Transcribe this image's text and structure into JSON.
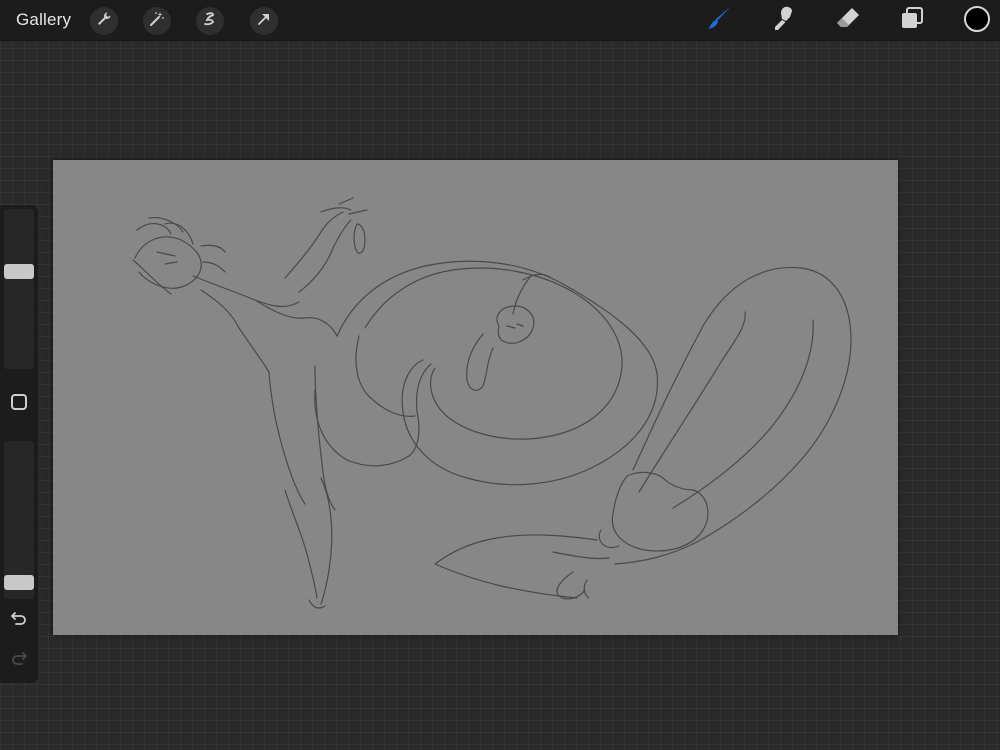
{
  "topbar": {
    "gallery_label": "Gallery",
    "left_tools": [
      "wrench-icon",
      "magic-wand-icon",
      "selection-icon",
      "transform-arrow-icon"
    ],
    "right_tools": [
      "brush-icon",
      "smudge-icon",
      "eraser-icon",
      "layers-icon"
    ],
    "active_tool": "brush",
    "accent_color": "#1a6fe0",
    "current_color": "#000000"
  },
  "sidebar": {
    "brush_size_level": 0.62,
    "opacity_level": 0.06,
    "buttons": [
      "modify-icon",
      "undo-icon",
      "redo-icon"
    ]
  },
  "canvas": {
    "background_color": "#878787",
    "content": "pencil-sketch"
  }
}
